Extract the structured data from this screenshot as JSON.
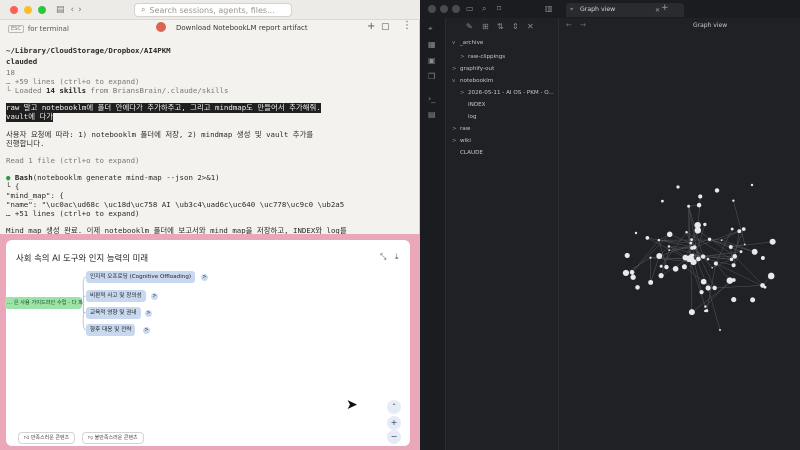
{
  "terminal": {
    "search_placeholder": "Search sessions, agents, files...",
    "esc_key": "ESC",
    "tab_label": "for terminal",
    "notification": "Download NotebookLM report artifact",
    "path": "~/Library/CloudStorage/Dropbox/AI4PKM",
    "cwd": "clauded",
    "lines": {
      "l_num": "18",
      "l_more1": "… +59 lines (ctrl+o to expand)",
      "l_loaded_pre": "└ Loaded ",
      "l_loaded_bold": "14 skills",
      "l_loaded_post": " from BriansBrain/.claude/skills",
      "l_user1": " raw 말고 notebooklm에 폴더 안에다가 추가하주고, 그리고 mindmap도 만들어서 추가해줘.",
      "l_user2": "vault에 다가",
      "l_resp1": "  사용자 요청에 따라: 1) notebooklm 폴더에 저장, 2) mindmap 생성 및 vault 추가를",
      "l_resp2": "  진행합니다.",
      "l_read": "  Read 1 file (ctrl+o to expand)",
      "l_bash_bold": "Bash",
      "l_bash_rest": "(notebooklm generate mind-map --json 2>&1)",
      "l_brace": "  └ {",
      "l_mm": "      \"mind_map\": {",
      "l_name": "        \"name\": \"\\uc0ac\\ud68c \\uc18d\\uc758 AI \\ub3c4\\uad6c\\uc640 \\uc778\\uc9c0 \\ub2a5",
      "l_more2": "  … +51 lines (ctrl+o to expand)",
      "l_cut": "Mind map 생성 완료. 이제 notebooklm 폴더에 보고서와 mind map을 저장하고, INDEX와 log를"
    }
  },
  "notebooklm": {
    "title": "사회 속의 AI 도구와 인지 능력의 미래",
    "root_node": "… 은 사용 가이드라인 수립 - 다 파면 - web 회의)",
    "nodes": [
      "인지적 오프로딩 (Cognitive Offloading)",
      "비판적 사고 및 창의성",
      "교육적 영향 및 권내",
      "향후 대응 및 전략"
    ],
    "expand_glyph": ">",
    "btn_good": "만족스러운 콘텐츠",
    "btn_bad": "불만족스러운 콘텐츠",
    "zoom_in": "+",
    "zoom_out": "−",
    "collapse_glyph": "⌃"
  },
  "obsidian": {
    "tab_title": "Graph view",
    "view_header": "Graph view",
    "tree": [
      {
        "label": "_archive",
        "depth": 0,
        "chev": "v"
      },
      {
        "label": "raw-clippings",
        "depth": 1,
        "chev": ">"
      },
      {
        "label": "graphify-out",
        "depth": 0,
        "chev": ">"
      },
      {
        "label": "notebooklm",
        "depth": 0,
        "chev": "v"
      },
      {
        "label": "2026-05-11 - AI OS - PKM - O...",
        "depth": 1,
        "chev": ">"
      },
      {
        "label": "INDEX",
        "depth": 1,
        "chev": ""
      },
      {
        "label": "log",
        "depth": 1,
        "chev": ""
      },
      {
        "label": "raw",
        "depth": 0,
        "chev": ">"
      },
      {
        "label": "wiki",
        "depth": 0,
        "chev": ">"
      },
      {
        "label": "CLAUDE",
        "depth": 0,
        "chev": ""
      }
    ]
  },
  "colors": {
    "accent_pink": "#e9a7b9",
    "mindmap_green": "#9be3a6",
    "mindmap_blue": "#c8d8ef",
    "terminal_bg": "#f4f2ee",
    "dark_bg": "#202124"
  }
}
